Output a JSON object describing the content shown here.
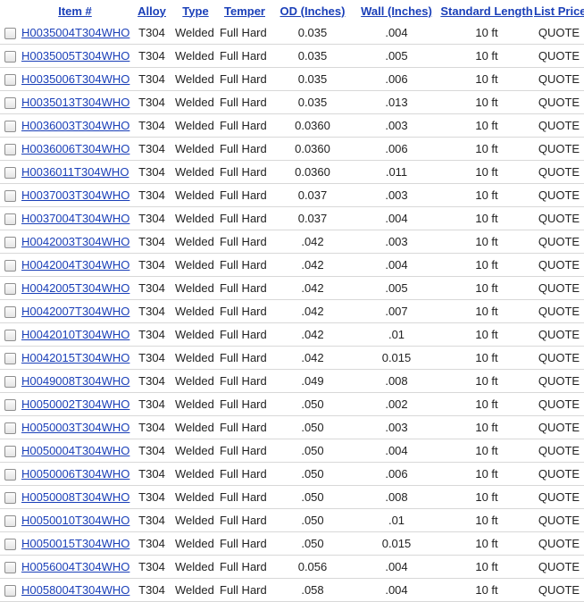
{
  "columns": [
    "Item #",
    "Alloy",
    "Type",
    "Temper",
    "OD (Inches)",
    "Wall (Inches)",
    "Standard Length",
    "List Price"
  ],
  "rows": [
    [
      "H0035004T304WHO",
      "T304",
      "Welded",
      "Full Hard",
      "0.035",
      ".004",
      "10 ft",
      "QUOTE"
    ],
    [
      "H0035005T304WHO",
      "T304",
      "Welded",
      "Full Hard",
      "0.035",
      ".005",
      "10 ft",
      "QUOTE"
    ],
    [
      "H0035006T304WHO",
      "T304",
      "Welded",
      "Full Hard",
      "0.035",
      ".006",
      "10 ft",
      "QUOTE"
    ],
    [
      "H0035013T304WHO",
      "T304",
      "Welded",
      "Full Hard",
      "0.035",
      ".013",
      "10 ft",
      "QUOTE"
    ],
    [
      "H0036003T304WHO",
      "T304",
      "Welded",
      "Full Hard",
      "0.0360",
      ".003",
      "10 ft",
      "QUOTE"
    ],
    [
      "H0036006T304WHO",
      "T304",
      "Welded",
      "Full Hard",
      "0.0360",
      ".006",
      "10 ft",
      "QUOTE"
    ],
    [
      "H0036011T304WHO",
      "T304",
      "Welded",
      "Full Hard",
      "0.0360",
      ".011",
      "10 ft",
      "QUOTE"
    ],
    [
      "H0037003T304WHO",
      "T304",
      "Welded",
      "Full Hard",
      "0.037",
      ".003",
      "10 ft",
      "QUOTE"
    ],
    [
      "H0037004T304WHO",
      "T304",
      "Welded",
      "Full Hard",
      "0.037",
      ".004",
      "10 ft",
      "QUOTE"
    ],
    [
      "H0042003T304WHO",
      "T304",
      "Welded",
      "Full Hard",
      ".042",
      ".003",
      "10 ft",
      "QUOTE"
    ],
    [
      "H0042004T304WHO",
      "T304",
      "Welded",
      "Full Hard",
      ".042",
      ".004",
      "10 ft",
      "QUOTE"
    ],
    [
      "H0042005T304WHO",
      "T304",
      "Welded",
      "Full Hard",
      ".042",
      ".005",
      "10 ft",
      "QUOTE"
    ],
    [
      "H0042007T304WHO",
      "T304",
      "Welded",
      "Full Hard",
      ".042",
      ".007",
      "10 ft",
      "QUOTE"
    ],
    [
      "H0042010T304WHO",
      "T304",
      "Welded",
      "Full Hard",
      ".042",
      ".01",
      "10 ft",
      "QUOTE"
    ],
    [
      "H0042015T304WHO",
      "T304",
      "Welded",
      "Full Hard",
      ".042",
      "0.015",
      "10 ft",
      "QUOTE"
    ],
    [
      "H0049008T304WHO",
      "T304",
      "Welded",
      "Full Hard",
      ".049",
      ".008",
      "10 ft",
      "QUOTE"
    ],
    [
      "H0050002T304WHO",
      "T304",
      "Welded",
      "Full Hard",
      ".050",
      ".002",
      "10 ft",
      "QUOTE"
    ],
    [
      "H0050003T304WHO",
      "T304",
      "Welded",
      "Full Hard",
      ".050",
      ".003",
      "10 ft",
      "QUOTE"
    ],
    [
      "H0050004T304WHO",
      "T304",
      "Welded",
      "Full Hard",
      ".050",
      ".004",
      "10 ft",
      "QUOTE"
    ],
    [
      "H0050006T304WHO",
      "T304",
      "Welded",
      "Full Hard",
      ".050",
      ".006",
      "10 ft",
      "QUOTE"
    ],
    [
      "H0050008T304WHO",
      "T304",
      "Welded",
      "Full Hard",
      ".050",
      ".008",
      "10 ft",
      "QUOTE"
    ],
    [
      "H0050010T304WHO",
      "T304",
      "Welded",
      "Full Hard",
      ".050",
      ".01",
      "10 ft",
      "QUOTE"
    ],
    [
      "H0050015T304WHO",
      "T304",
      "Welded",
      "Full Hard",
      ".050",
      "0.015",
      "10 ft",
      "QUOTE"
    ],
    [
      "H0056004T304WHO",
      "T304",
      "Welded",
      "Full Hard",
      "0.056",
      ".004",
      "10 ft",
      "QUOTE"
    ],
    [
      "H0058004T304WHO",
      "T304",
      "Welded",
      "Full Hard",
      ".058",
      ".004",
      "10 ft",
      "QUOTE"
    ]
  ],
  "colors": {
    "link": "#1a3fb8",
    "divider": "#d8d8d8",
    "text": "#222222"
  }
}
